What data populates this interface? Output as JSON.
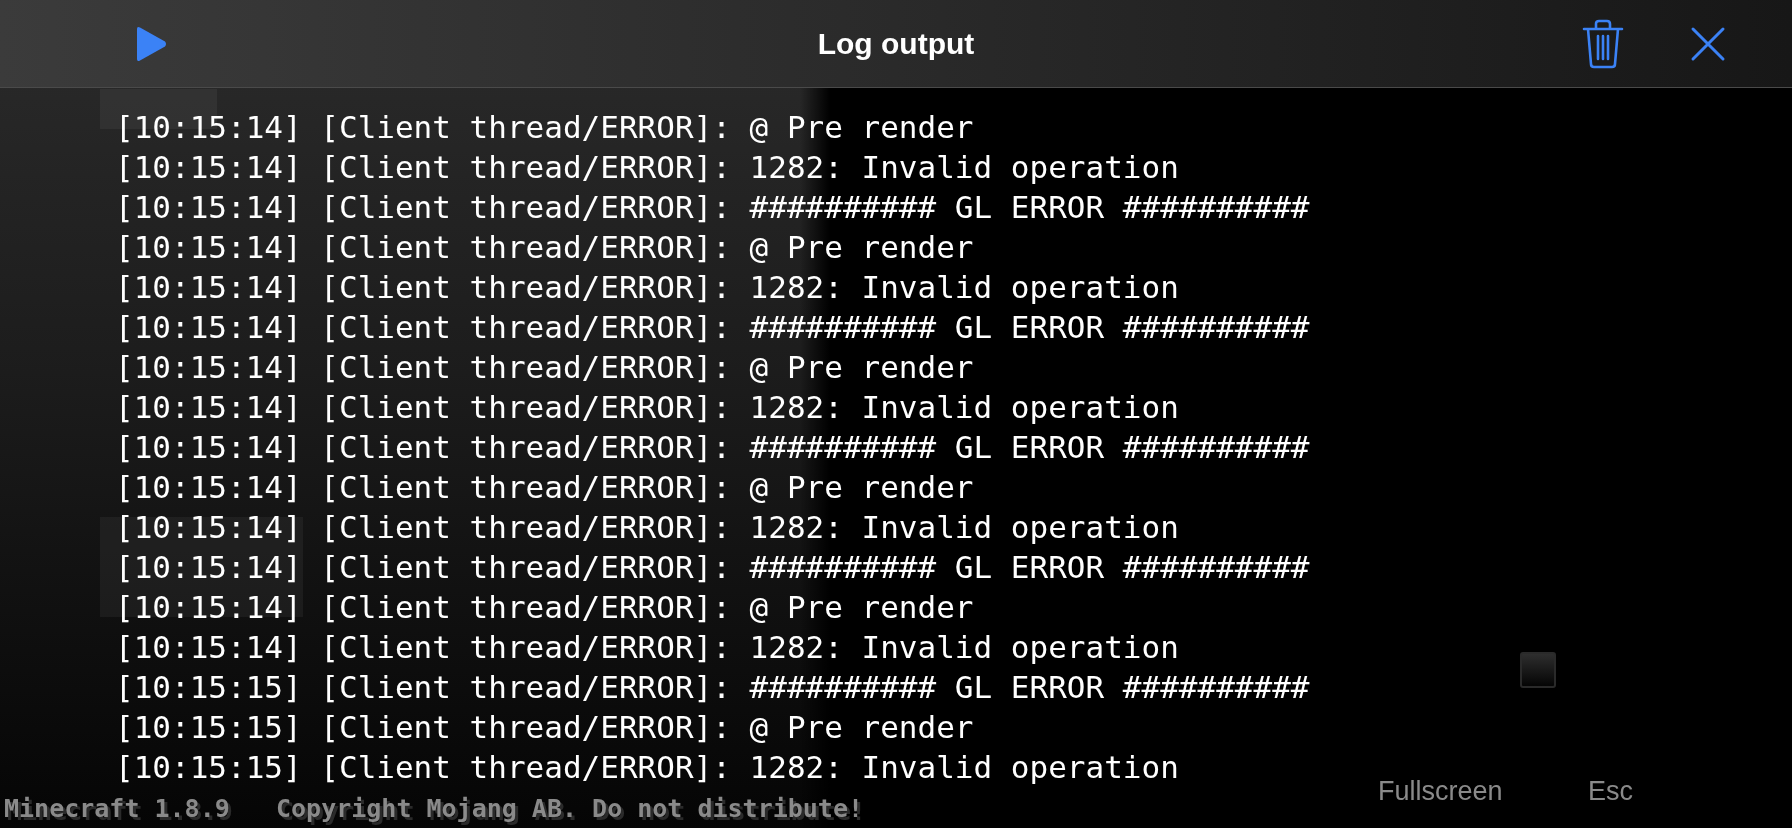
{
  "header": {
    "title": "Log output"
  },
  "log_lines": [
    "[10:15:14] [Client thread/ERROR]: @ Pre render",
    "[10:15:14] [Client thread/ERROR]: 1282: Invalid operation",
    "[10:15:14] [Client thread/ERROR]: ########## GL ERROR ##########",
    "[10:15:14] [Client thread/ERROR]: @ Pre render",
    "[10:15:14] [Client thread/ERROR]: 1282: Invalid operation",
    "[10:15:14] [Client thread/ERROR]: ########## GL ERROR ##########",
    "[10:15:14] [Client thread/ERROR]: @ Pre render",
    "[10:15:14] [Client thread/ERROR]: 1282: Invalid operation",
    "[10:15:14] [Client thread/ERROR]: ########## GL ERROR ##########",
    "[10:15:14] [Client thread/ERROR]: @ Pre render",
    "[10:15:14] [Client thread/ERROR]: 1282: Invalid operation",
    "[10:15:14] [Client thread/ERROR]: ########## GL ERROR ##########",
    "[10:15:14] [Client thread/ERROR]: @ Pre render",
    "[10:15:14] [Client thread/ERROR]: 1282: Invalid operation",
    "[10:15:15] [Client thread/ERROR]: ########## GL ERROR ##########",
    "[10:15:15] [Client thread/ERROR]: @ Pre render",
    "[10:15:15] [Client thread/ERROR]: 1282: Invalid operation"
  ],
  "game_footer": {
    "version": "Minecraft 1.8.9",
    "copyright": "Copyright Mojang AB. Do not distribute!"
  },
  "game_buttons": [
    "Fullscreen",
    "Esc"
  ]
}
